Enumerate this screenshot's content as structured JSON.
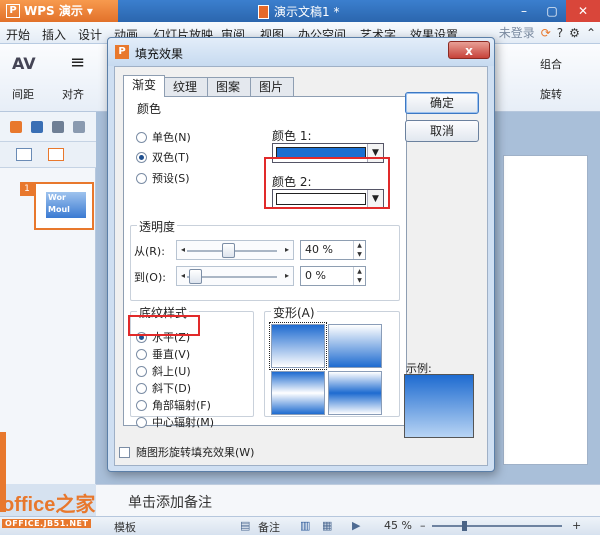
{
  "app": {
    "brand": "WPS 演示",
    "brand_logo": "P",
    "doc_title": "演示文稿1 *"
  },
  "menubar": {
    "items": [
      "开始",
      "插入",
      "设计",
      "动画",
      "幻灯片放映",
      "审阅",
      "视图",
      "办公空间",
      "艺术字",
      "效果设置"
    ],
    "login": "未登录"
  },
  "ribbon": {
    "left_icon_text": "AV",
    "left_items": [
      "间距",
      "对齐"
    ],
    "right_items": [
      "组合",
      "旋转"
    ]
  },
  "slide": {
    "number": "1",
    "thumb_text": "Wor\nMoul"
  },
  "notes": {
    "placeholder": "单击添加备注"
  },
  "statusbar": {
    "template": "模板",
    "notes": "备注",
    "zoom": "45 %"
  },
  "watermark": {
    "main": "office之家",
    "sub": "OFFICE.JB51.NET"
  },
  "dialog": {
    "icon": "P",
    "title": "填充效果",
    "close": "x",
    "tabs": [
      "渐变",
      "纹理",
      "图案",
      "图片"
    ],
    "colors_group": "颜色",
    "color_options": [
      "单色(N)",
      "双色(T)",
      "预设(S)"
    ],
    "color1_label": "颜色 1:",
    "color2_label": "颜色 2:",
    "color1_value": "#1a6fd2",
    "color2_value": "#ffffff",
    "transparency_group": "透明度",
    "from_label": "从(R):",
    "to_label": "到(O):",
    "from_value": "40 %",
    "to_value": "0 %",
    "from_slider": 0.4,
    "to_slider": 0.0,
    "shading_group": "底纹样式",
    "shading_options": [
      "水平(Z)",
      "垂直(V)",
      "斜上(U)",
      "斜下(D)",
      "角部辐射(F)",
      "中心辐射(M)"
    ],
    "variants_label": "变形(A)",
    "ok": "确定",
    "cancel": "取消",
    "sample_label": "示例:",
    "rotate_with_shape": "随图形旋转填充效果(W)"
  }
}
